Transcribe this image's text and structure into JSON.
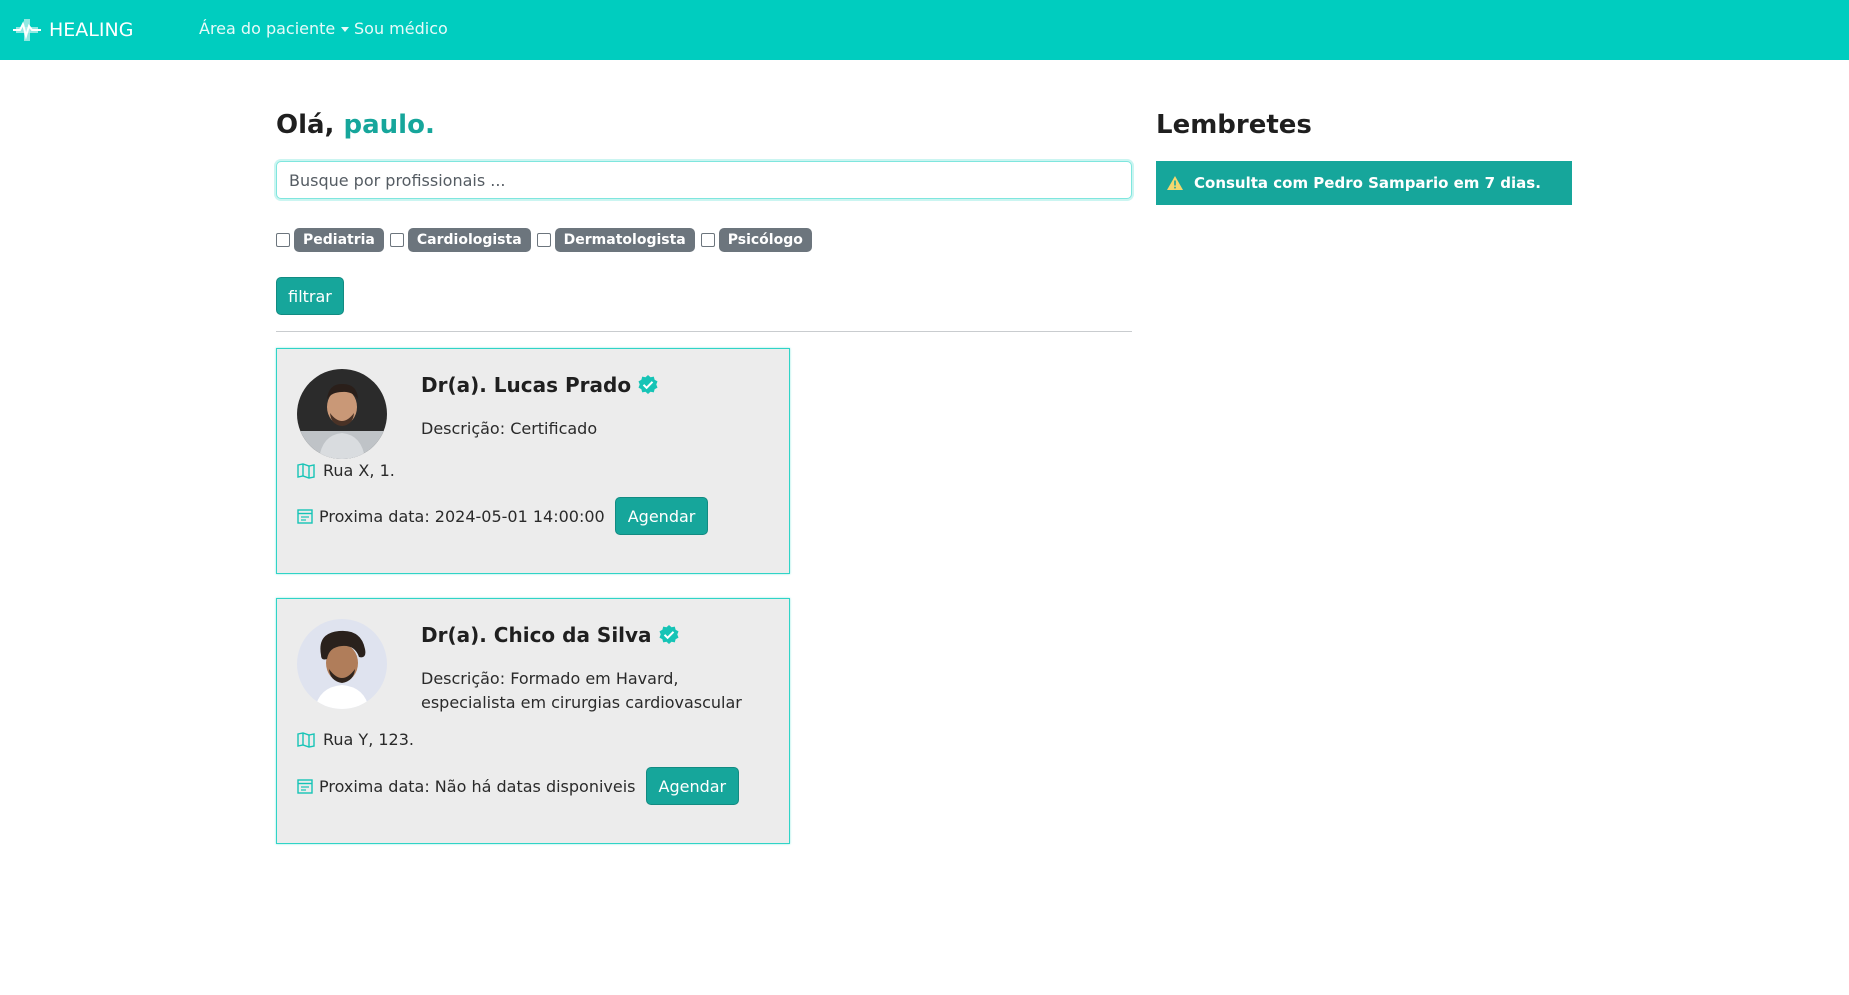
{
  "navbar": {
    "brand": "HEALING",
    "area_paciente": "Área do paciente",
    "sou_medico": "Sou médico"
  },
  "greeting": {
    "prefix": "Olá, ",
    "name": "paulo."
  },
  "search": {
    "placeholder": "Busque por profissionais ..."
  },
  "filters": {
    "specialties": [
      "Pediatria",
      "Cardiologista",
      "Dermatologista",
      "Psicólogo"
    ],
    "button": "filtrar"
  },
  "doctors": [
    {
      "name": "Dr(a). Lucas Prado",
      "description": "Descrição: Certificado",
      "address": "Rua X, 1.",
      "next_date": "Proxima data: 2024-05-01 14:00:00",
      "action": "Agendar"
    },
    {
      "name": "Dr(a). Chico da Silva",
      "description": "Descrição: Formado em Havard, especialista em cirurgias cardiovascular",
      "address": "Rua Y, 123.",
      "next_date": "Proxima data: Não há datas disponiveis",
      "action": "Agendar"
    }
  ],
  "reminders": {
    "title": "Lembretes",
    "items": [
      "Consulta com Pedro Sampario em 7 dias."
    ]
  },
  "colors": {
    "navbar": "#00cdbf",
    "accent": "#16a69b",
    "badge": "#6c757d",
    "card_bg": "#ececec"
  }
}
